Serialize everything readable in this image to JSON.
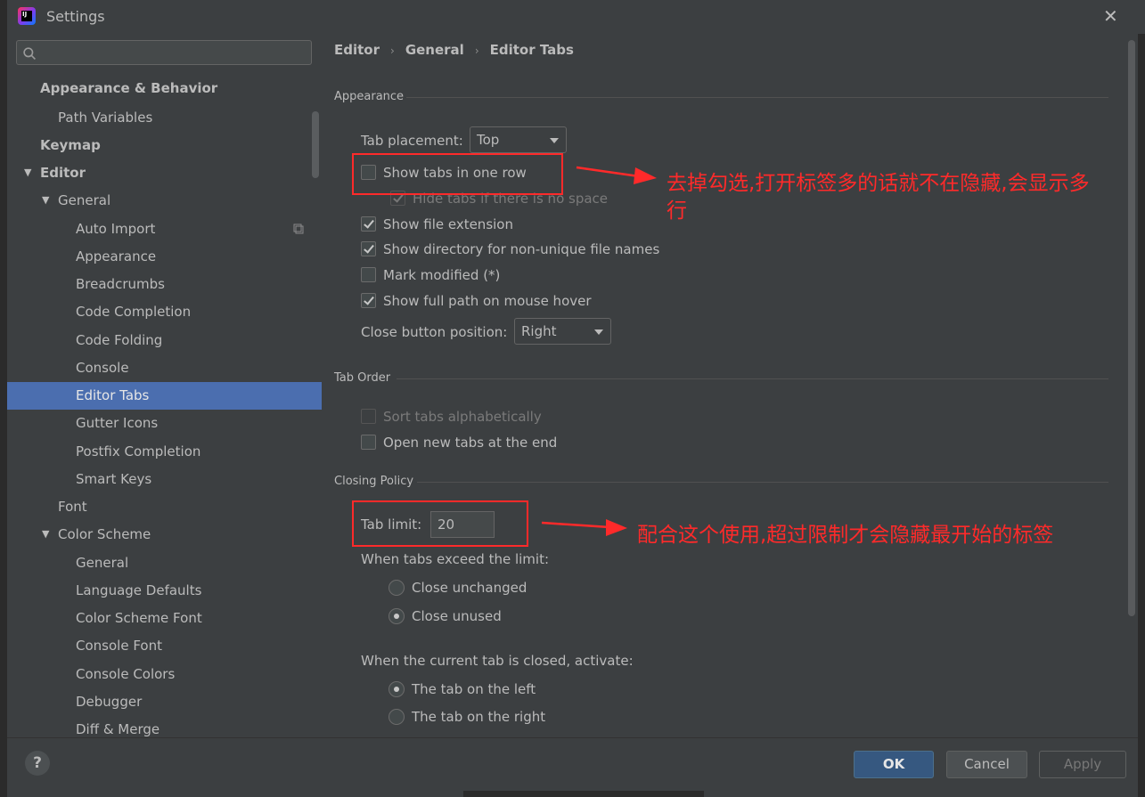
{
  "window": {
    "title": "Settings"
  },
  "search": {
    "placeholder": ""
  },
  "sidebar": {
    "items": [
      {
        "label": "Appearance & Behavior",
        "bold": true
      },
      {
        "label": "Path Variables"
      },
      {
        "label": "Keymap",
        "bold": true
      },
      {
        "label": "Editor",
        "bold": true,
        "expanded": true
      },
      {
        "label": "General",
        "expanded": true
      },
      {
        "label": "Auto Import"
      },
      {
        "label": "Appearance"
      },
      {
        "label": "Breadcrumbs"
      },
      {
        "label": "Code Completion"
      },
      {
        "label": "Code Folding"
      },
      {
        "label": "Console"
      },
      {
        "label": "Editor Tabs",
        "selected": true
      },
      {
        "label": "Gutter Icons"
      },
      {
        "label": "Postfix Completion"
      },
      {
        "label": "Smart Keys"
      },
      {
        "label": "Font"
      },
      {
        "label": "Color Scheme",
        "expanded": true
      },
      {
        "label": "General"
      },
      {
        "label": "Language Defaults"
      },
      {
        "label": "Color Scheme Font"
      },
      {
        "label": "Console Font"
      },
      {
        "label": "Console Colors"
      },
      {
        "label": "Debugger"
      },
      {
        "label": "Diff & Merge"
      }
    ]
  },
  "breadcrumb": [
    "Editor",
    "General",
    "Editor Tabs"
  ],
  "appearance": {
    "section": "Appearance",
    "tab_placement_label": "Tab placement:",
    "tab_placement_value": "Top",
    "show_tabs_one_row": {
      "label": "Show tabs in one row",
      "checked": false
    },
    "hide_tabs_no_space": {
      "label": "Hide tabs if there is no space",
      "checked": true,
      "disabled": true
    },
    "show_file_extension": {
      "label": "Show file extension",
      "checked": true
    },
    "show_directory": {
      "label": "Show directory for non-unique file names",
      "checked": true
    },
    "mark_modified": {
      "label": "Mark modified (*)",
      "checked": false
    },
    "show_full_path": {
      "label": "Show full path on mouse hover",
      "checked": true
    },
    "close_button_label": "Close button position:",
    "close_button_value": "Right"
  },
  "tab_order": {
    "section": "Tab Order",
    "sort_alpha": {
      "label": "Sort tabs alphabetically",
      "checked": false,
      "disabled": true
    },
    "open_at_end": {
      "label": "Open new tabs at the end",
      "checked": false
    }
  },
  "closing_policy": {
    "section": "Closing Policy",
    "tab_limit_label": "Tab limit:",
    "tab_limit_value": "20",
    "exceed_label": "When tabs exceed the limit:",
    "close_unchanged": "Close unchanged",
    "close_unused": "Close unused",
    "activate_label": "When the current tab is closed, activate:",
    "tab_left": "The tab on the left",
    "tab_right": "The tab on the right"
  },
  "annotations": {
    "note1_line1": "去掉勾选,打开标签多的话就不在隐藏,会显示多",
    "note1_line2": "行",
    "note2": "配合这个使用,超过限制才会隐藏最开始的标签",
    "color": "#ff2a2a"
  },
  "buttons": {
    "help": "?",
    "ok": "OK",
    "cancel": "Cancel",
    "apply": "Apply"
  },
  "colors": {
    "selection": "#4b6eaf",
    "ok_button": "#365880",
    "background": "#3c3f41"
  }
}
